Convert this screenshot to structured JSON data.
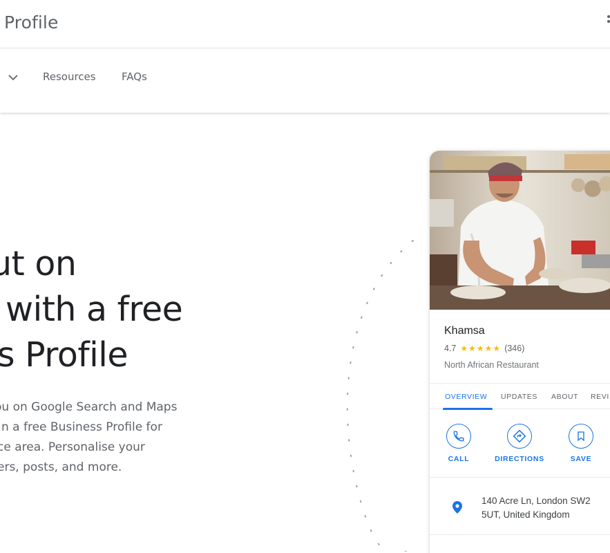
{
  "header": {
    "brand": "Profile"
  },
  "subnav": {
    "links": [
      "Resources",
      "FAQs"
    ]
  },
  "hero": {
    "headline_lines": [
      "ut on",
      "with a free",
      "s Profile"
    ],
    "description_lines": [
      "ou on Google Search and Maps",
      "n a free Business Profile for",
      "ce area. Personalise your",
      "ers, posts, and more."
    ]
  },
  "card": {
    "name": "Khamsa",
    "rating": "4.7",
    "stars": "★★★★★",
    "review_count": "(346)",
    "category": "North African Restaurant",
    "tabs": [
      "OVERVIEW",
      "UPDATES",
      "ABOUT",
      "REVI"
    ],
    "active_tab": "OVERVIEW",
    "actions": [
      "CALL",
      "DIRECTIONS",
      "SAVE"
    ],
    "address_lines": [
      "140 Acre Ln, London SW2",
      "5UT, United Kingdom"
    ]
  },
  "colors": {
    "accent": "#1a73e8",
    "star": "#fbbc04",
    "text": "#202124",
    "muted": "#5f6368"
  }
}
